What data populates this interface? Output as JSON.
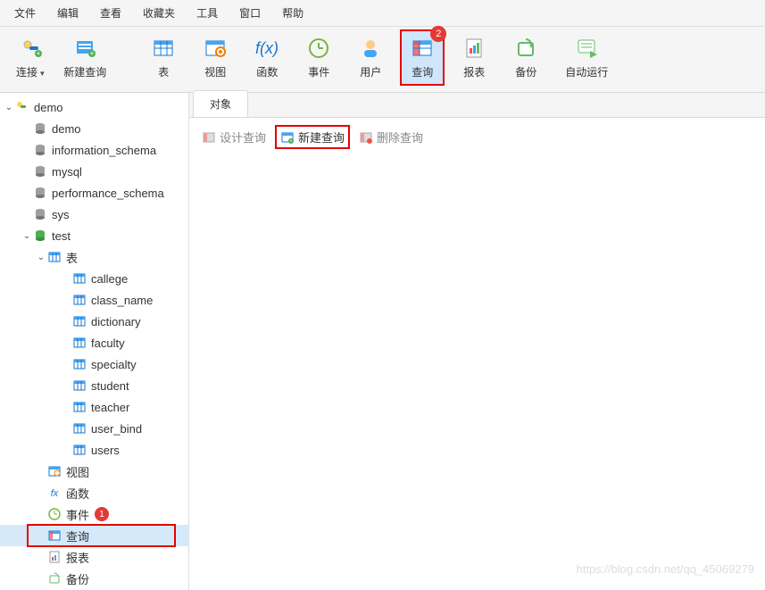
{
  "menu": [
    "文件",
    "编辑",
    "查看",
    "收藏夹",
    "工具",
    "窗口",
    "帮助"
  ],
  "toolbar": [
    {
      "id": "connect",
      "label": "连接",
      "dropdown": true
    },
    {
      "id": "newquery",
      "label": "新建查询"
    },
    {
      "id": "table",
      "label": "表"
    },
    {
      "id": "view",
      "label": "视图"
    },
    {
      "id": "function",
      "label": "函数"
    },
    {
      "id": "event",
      "label": "事件"
    },
    {
      "id": "user",
      "label": "用户"
    },
    {
      "id": "query",
      "label": "查询",
      "selected": true,
      "highlight": true,
      "badge": "2"
    },
    {
      "id": "report",
      "label": "报表"
    },
    {
      "id": "backup",
      "label": "备份"
    },
    {
      "id": "autorun",
      "label": "自动运行"
    }
  ],
  "tree": {
    "root": {
      "label": "demo",
      "icon": "connection"
    },
    "databases": [
      {
        "label": "demo",
        "icon": "db"
      },
      {
        "label": "information_schema",
        "icon": "db"
      },
      {
        "label": "mysql",
        "icon": "db"
      },
      {
        "label": "performance_schema",
        "icon": "db"
      },
      {
        "label": "sys",
        "icon": "db"
      },
      {
        "label": "test",
        "icon": "db-active",
        "expanded": true
      }
    ],
    "test_children": [
      {
        "label": "表",
        "icon": "table-folder",
        "expanded": true
      },
      {
        "label": "视图",
        "icon": "view"
      },
      {
        "label": "函数",
        "icon": "fx"
      },
      {
        "label": "事件",
        "icon": "event",
        "badge": "1"
      },
      {
        "label": "查询",
        "icon": "query",
        "selected": true,
        "highlight": true
      },
      {
        "label": "报表",
        "icon": "report"
      },
      {
        "label": "备份",
        "icon": "backup"
      }
    ],
    "tables": [
      "callege",
      "class_name",
      "dictionary",
      "faculty",
      "specialty",
      "student",
      "teacher",
      "user_bind",
      "users"
    ]
  },
  "tabs": {
    "active": "对象"
  },
  "actions": [
    {
      "id": "design",
      "label": "设计查询",
      "enabled": false
    },
    {
      "id": "new",
      "label": "新建查询",
      "enabled": true,
      "highlight": true
    },
    {
      "id": "delete",
      "label": "删除查询",
      "enabled": false
    }
  ],
  "watermark": "https://blog.csdn.net/qq_45069279"
}
